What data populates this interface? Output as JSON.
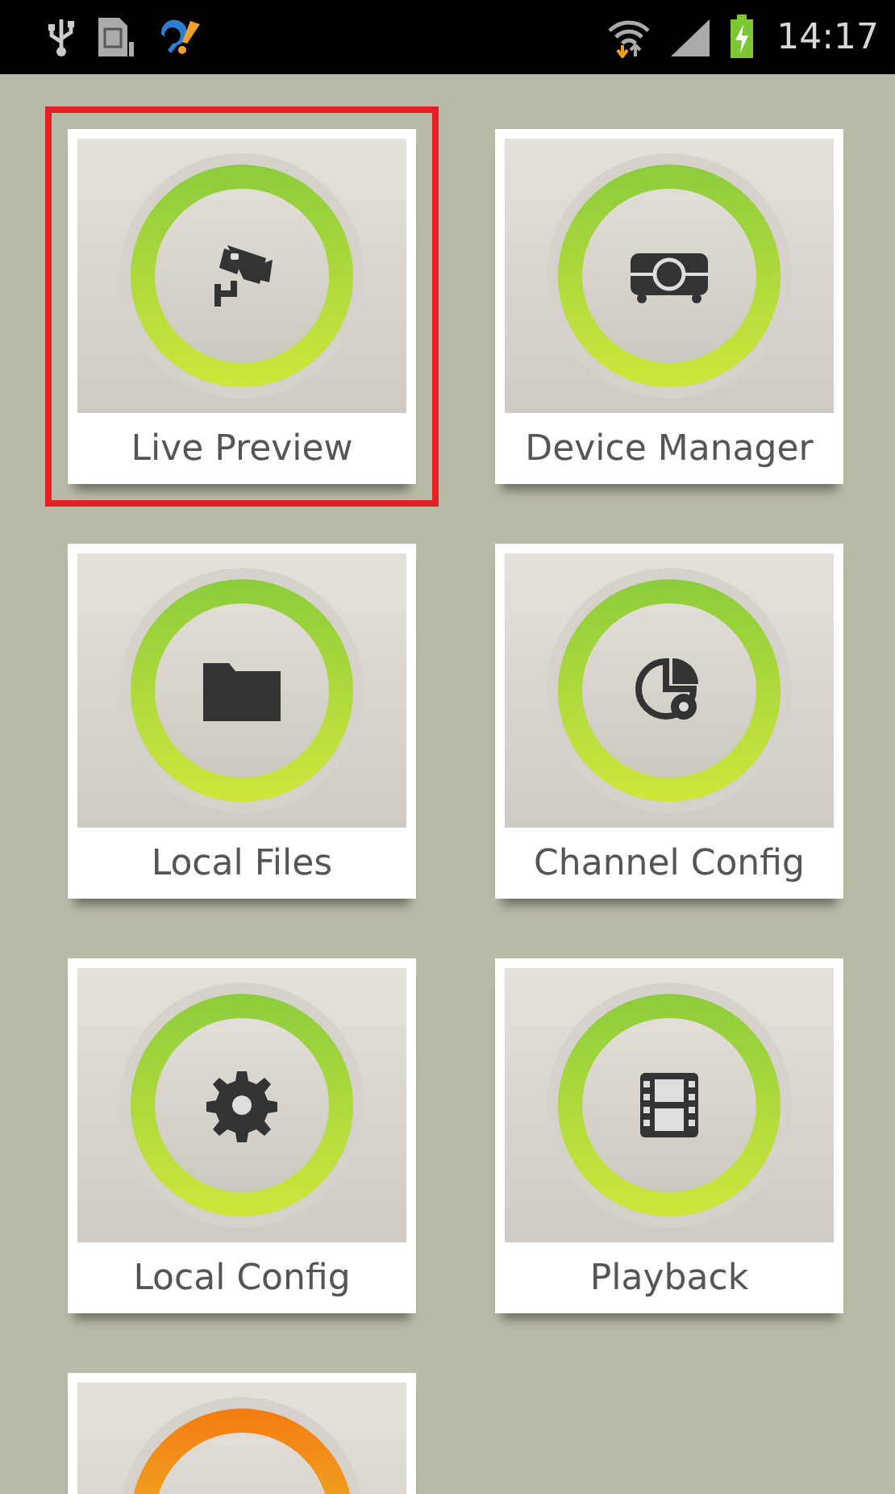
{
  "status_bar": {
    "time": "14:17"
  },
  "tiles": [
    {
      "label": "Live Preview",
      "selected": true,
      "color": "#8ccc3c"
    },
    {
      "label": "Device Manager",
      "selected": false,
      "color": "#8ccc3c"
    },
    {
      "label": "Local Files",
      "selected": false,
      "color": "#8ccc3c"
    },
    {
      "label": "Channel Config",
      "selected": false,
      "color": "#8ccc3c"
    },
    {
      "label": "Local Config",
      "selected": false,
      "color": "#8ccc3c"
    },
    {
      "label": "Playback",
      "selected": false,
      "color": "#8ccc3c"
    },
    {
      "selected": false,
      "color": "#f47b12"
    }
  ]
}
